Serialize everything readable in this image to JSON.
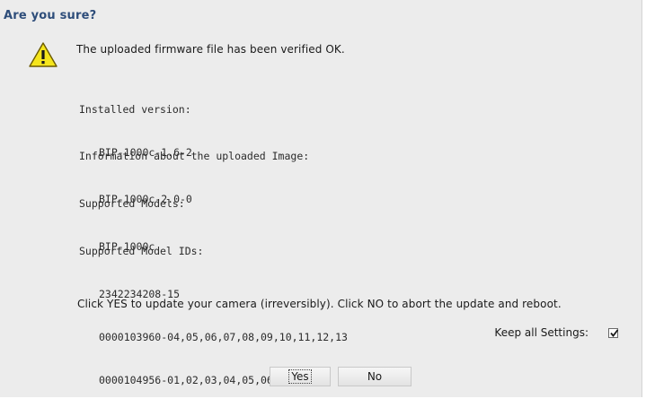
{
  "dialog": {
    "title": "Are you sure?",
    "icon": "warning-icon",
    "headline": "The uploaded firmware file has been verified OK.",
    "installed": {
      "label": "Installed version:",
      "value": "BIP-1000c-1.6-2"
    },
    "uploaded": {
      "label": "Information about the uploaded Image:",
      "value": "BIP-1000c-2.0-0"
    },
    "models": {
      "label": "Supported Models:",
      "value": "BIP-1000c"
    },
    "model_ids": {
      "label": "Supported Model IDs:",
      "values": [
        "2342234208-15",
        "0000103960-04,05,06,07,08,09,10,11,12,13",
        "0000104956-01,02,03,04,05,06,07,08"
      ]
    },
    "prompt": "Click YES to update your camera (irreversibly). Click NO to abort the update and reboot.",
    "keep_settings": {
      "label": "Keep all Settings:",
      "checked": true
    },
    "buttons": {
      "yes": "Yes",
      "no": "No"
    }
  },
  "colors": {
    "title": "#2e4d7a",
    "background": "#ececec",
    "warning_fill": "#f5e51c"
  }
}
